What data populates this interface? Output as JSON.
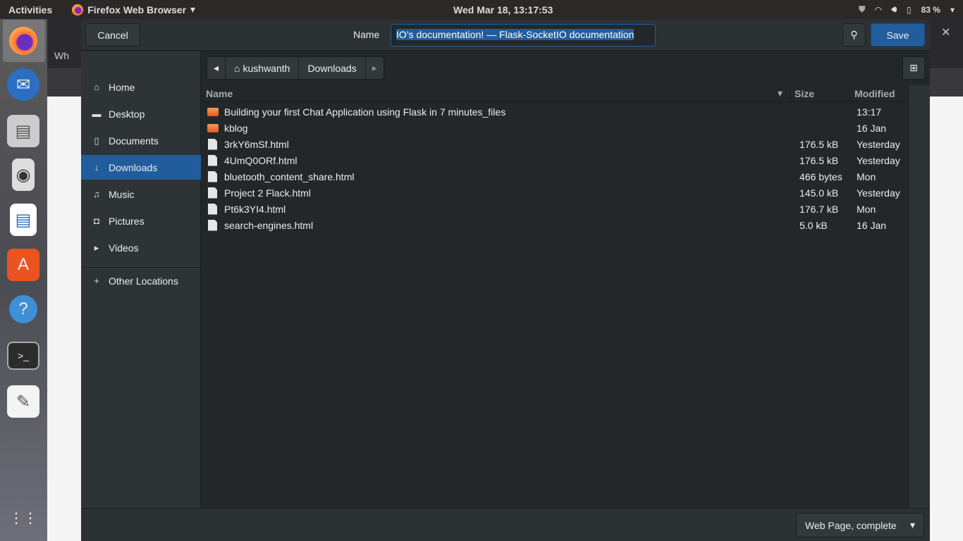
{
  "topbar": {
    "activities": "Activities",
    "app_name": "Firefox Web Browser",
    "clock": "Wed Mar 18, 13:17:53",
    "battery": "83 %"
  },
  "background": {
    "tab_partial": "Wh"
  },
  "dialog": {
    "cancel_label": "Cancel",
    "name_label": "Name",
    "name_value": "IO’s documentation! — Flask-SocketIO documentation",
    "save_label": "Save",
    "sidebar": [
      {
        "label": "Home",
        "icon": "home-icon"
      },
      {
        "label": "Desktop",
        "icon": "folder-icon"
      },
      {
        "label": "Documents",
        "icon": "document-icon"
      },
      {
        "label": "Downloads",
        "icon": "download-icon",
        "selected": true
      },
      {
        "label": "Music",
        "icon": "music-icon"
      },
      {
        "label": "Pictures",
        "icon": "camera-icon"
      },
      {
        "label": "Videos",
        "icon": "video-icon"
      },
      {
        "label": "Other Locations",
        "icon": "plus-icon"
      }
    ],
    "path": [
      "kushwanth",
      "Downloads"
    ],
    "columns": {
      "name": "Name",
      "size": "Size",
      "modified": "Modified"
    },
    "files": [
      {
        "name": "Building your first Chat Application using Flask in 7 minutes_files",
        "size": "",
        "modified": "13:17",
        "type": "folder"
      },
      {
        "name": "kblog",
        "size": "",
        "modified": "16 Jan",
        "type": "folder"
      },
      {
        "name": "3rkY6mSf.html",
        "size": "176.5 kB",
        "modified": "Yesterday",
        "type": "file"
      },
      {
        "name": "4UmQ0ORf.html",
        "size": "176.5 kB",
        "modified": "Yesterday",
        "type": "file"
      },
      {
        "name": "bluetooth_content_share.html",
        "size": "466 bytes",
        "modified": "Mon",
        "type": "file"
      },
      {
        "name": "Project 2  Flack.html",
        "size": "145.0 kB",
        "modified": "Yesterday",
        "type": "file"
      },
      {
        "name": "Pt6k3YI4.html",
        "size": "176.7 kB",
        "modified": "Mon",
        "type": "file"
      },
      {
        "name": "search-engines.html",
        "size": "5.0 kB",
        "modified": "16 Jan",
        "type": "file"
      }
    ],
    "format_select": "Web Page, complete"
  }
}
